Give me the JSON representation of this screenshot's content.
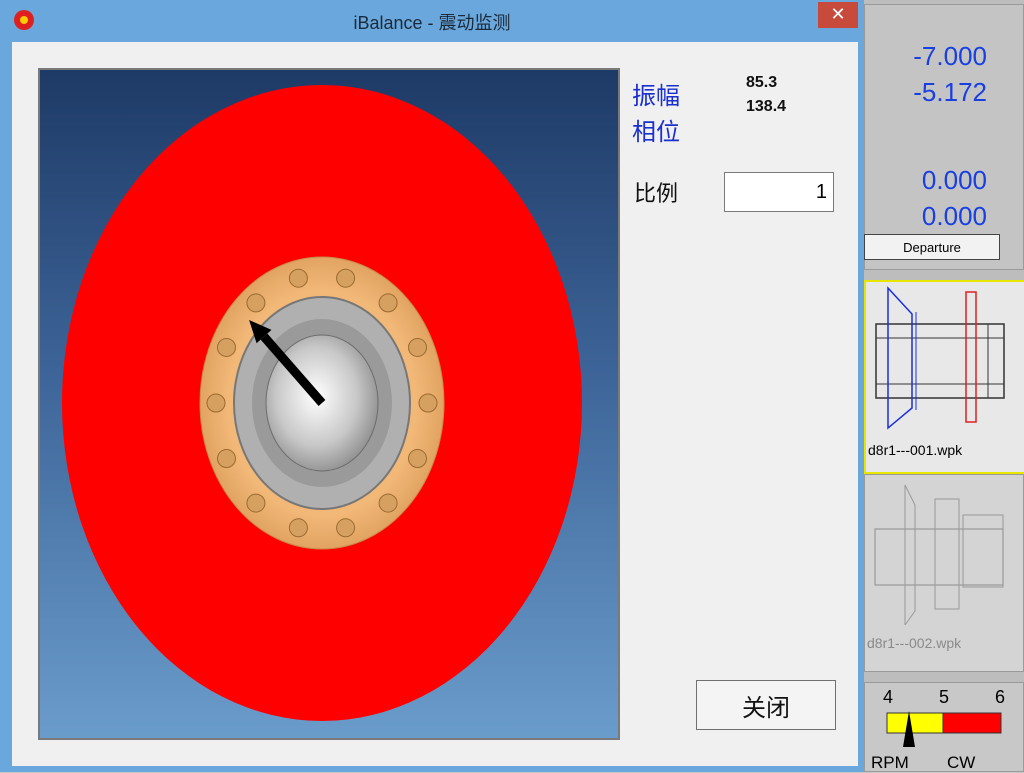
{
  "window": {
    "title": "iBalance - 震动监测",
    "close_glyph": "✕"
  },
  "readout": {
    "amplitude_label": "振幅",
    "phase_label": "相位",
    "amplitude_value": "85.3",
    "phase_value": "138.4",
    "scale_label": "比例",
    "scale_value": "1"
  },
  "close_button": {
    "label": "关闭"
  },
  "vector": {
    "phase_deg": 138.4,
    "amplitude": 85.3
  },
  "background_app": {
    "coords": [
      "-7.000",
      "-5.172",
      "0.000",
      "0.000"
    ],
    "departure_label": "Departure",
    "part_files": [
      "d8r1---001.wpk",
      "d8r1---002.wpk"
    ],
    "rpm_ticks": [
      "4",
      "5",
      "6"
    ],
    "rpm_label": "RPM",
    "direction_label": "CW"
  },
  "colors": {
    "disk": "#ff0000",
    "flange": "#e8a868",
    "vector": "#000000",
    "coord_text": "#1a3fe0",
    "titlebar": "#6aa7dc"
  }
}
